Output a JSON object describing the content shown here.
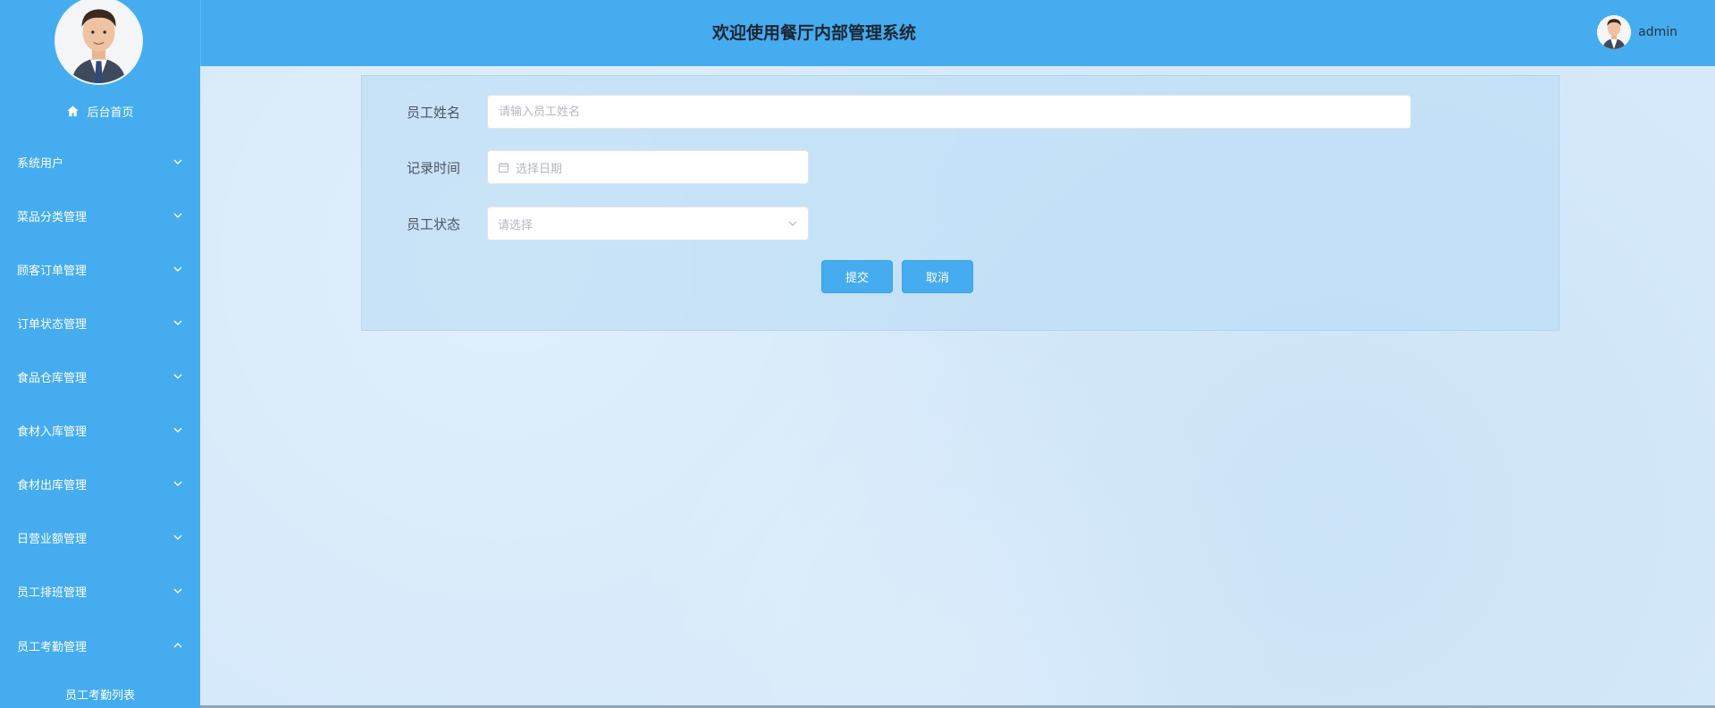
{
  "header": {
    "title": "欢迎使用餐厅内部管理系统",
    "username": "admin"
  },
  "sidebar": {
    "home_label": "后台首页",
    "items": [
      {
        "label": "系统用户",
        "expanded": false
      },
      {
        "label": "菜品分类管理",
        "expanded": false
      },
      {
        "label": "顾客订单管理",
        "expanded": false
      },
      {
        "label": "订单状态管理",
        "expanded": false
      },
      {
        "label": "食品仓库管理",
        "expanded": false
      },
      {
        "label": "食材入库管理",
        "expanded": false
      },
      {
        "label": "食材出库管理",
        "expanded": false
      },
      {
        "label": "日营业额管理",
        "expanded": false
      },
      {
        "label": "员工排班管理",
        "expanded": false
      },
      {
        "label": "员工考勤管理",
        "expanded": true
      }
    ],
    "submenu_item": "员工考勤列表"
  },
  "form": {
    "name_label": "员工姓名",
    "name_placeholder": "请输入员工姓名",
    "time_label": "记录时间",
    "time_placeholder": "选择日期",
    "status_label": "员工状态",
    "status_placeholder": "请选择",
    "submit_label": "提交",
    "cancel_label": "取消"
  },
  "colors": {
    "primary": "#45acef",
    "background": "#d6e9fa"
  }
}
